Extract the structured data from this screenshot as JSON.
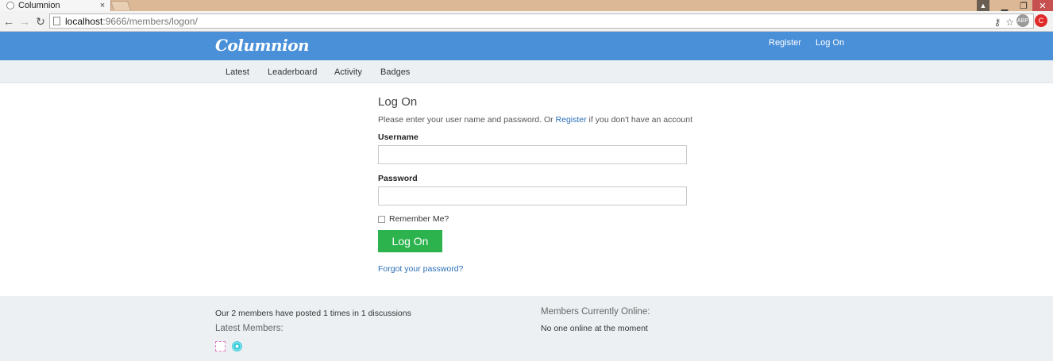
{
  "browser": {
    "tab_title": "Columnion",
    "tab_close": "×",
    "url_host": "localhost",
    "url_path": ":9666/members/logon/",
    "ext_abp": "ABP",
    "ext_cs": "C"
  },
  "site": {
    "logo": "Columnion",
    "top_links": {
      "register": "Register",
      "logon": "Log On"
    },
    "subnav": [
      "Latest",
      "Leaderboard",
      "Activity",
      "Badges"
    ]
  },
  "form": {
    "title": "Log On",
    "intro_before": "Please enter your user name and password. Or ",
    "intro_link": "Register",
    "intro_after": " if you don't have an account",
    "username_label": "Username",
    "username_value": "",
    "password_label": "Password",
    "password_value": "",
    "remember_label": "Remember Me?",
    "submit_label": "Log On",
    "forgot_label": "Forgot your password?"
  },
  "footer": {
    "stats": "Our 2 members have posted 1 times in 1 discussions",
    "latest_heading": "Latest Members:",
    "online_heading": "Members Currently Online:",
    "online_text": "No one online at the moment"
  },
  "colors": {
    "navbar": "#4a90d9",
    "subnav": "#edf0f2",
    "button": "#2cb34d",
    "link": "#2a6fb8"
  }
}
